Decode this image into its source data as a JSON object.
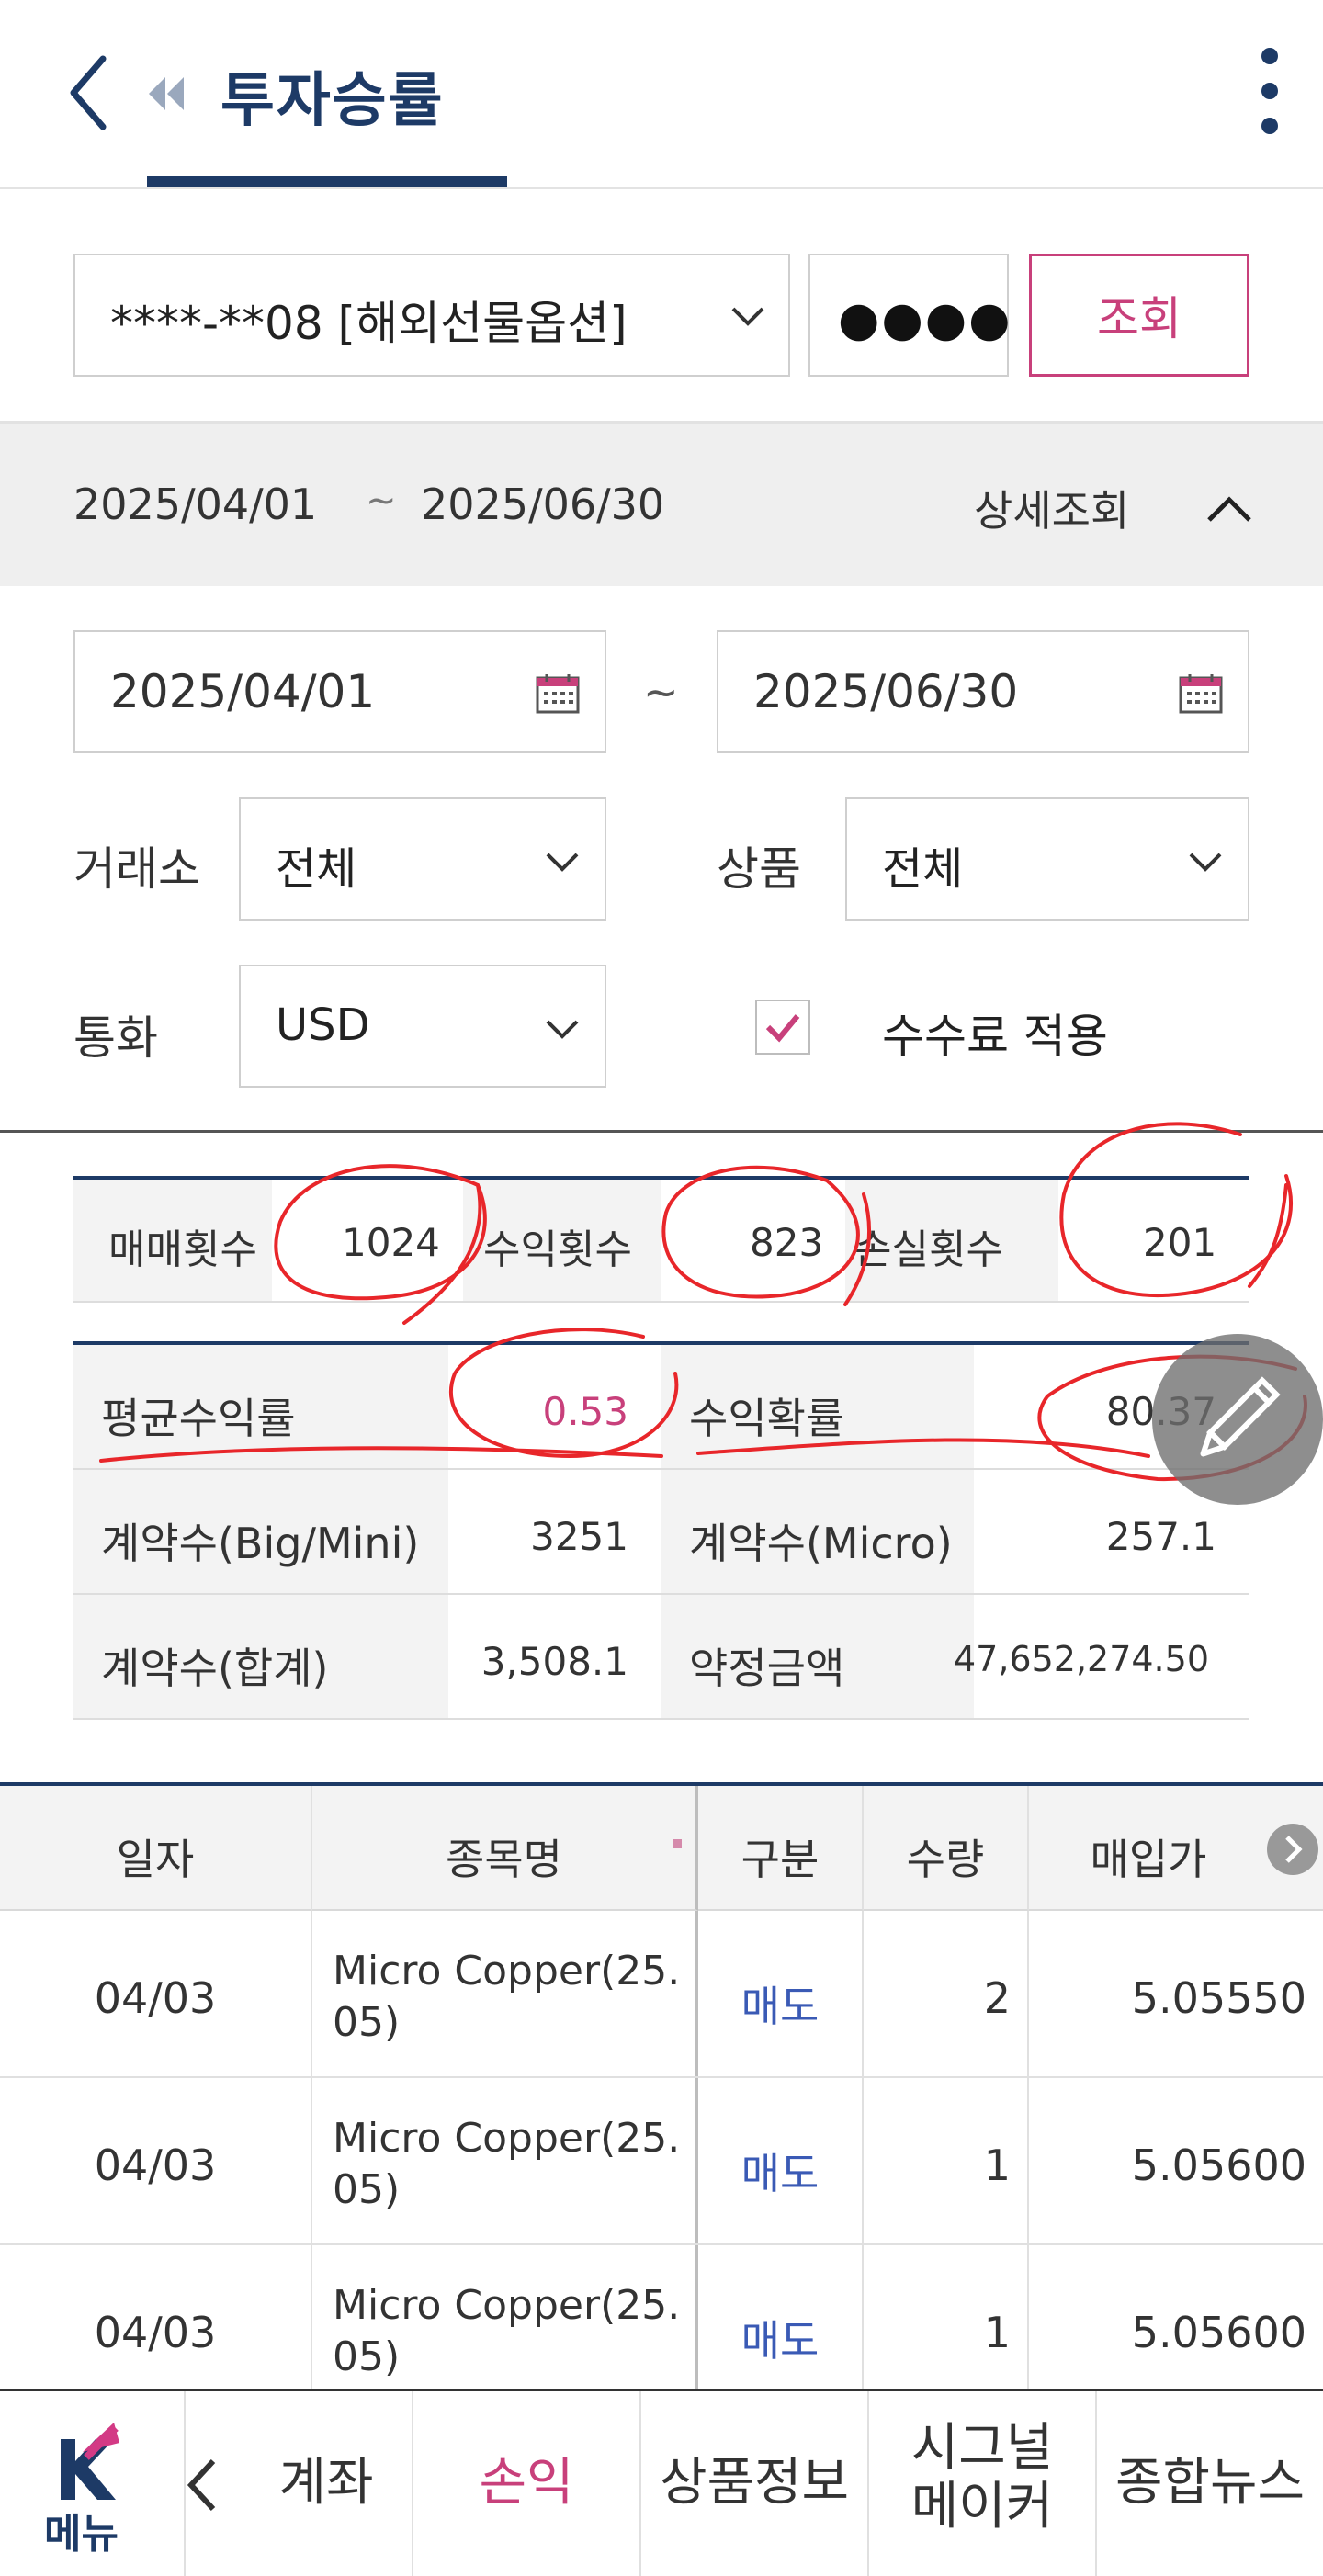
{
  "header": {
    "title": "투자승률"
  },
  "account": {
    "selected": "****-**08 [해외선물옵션]",
    "password_mask": "●●●●",
    "query_label": "조회"
  },
  "period": {
    "start": "2025/04/01",
    "separator": "~",
    "end": "2025/06/30",
    "detail_label": "상세조회"
  },
  "date_range": {
    "start": "2025/04/01",
    "separator": "~",
    "end": "2025/06/30"
  },
  "filters": {
    "exchange_label": "거래소",
    "exchange_value": "전체",
    "product_label": "상품",
    "product_value": "전체",
    "currency_label": "통화",
    "currency_value": "USD",
    "fee_label": "수수료 적용",
    "fee_checked": true
  },
  "stats1": {
    "trades_label": "매매횟수",
    "trades_value": "1024",
    "wins_label": "수익횟수",
    "wins_value": "823",
    "losses_label": "손실횟수",
    "losses_value": "201"
  },
  "stats2": {
    "avg_return_label": "평균수익률",
    "avg_return_value": "0.53",
    "win_rate_label": "수익확률",
    "win_rate_value": "80.37",
    "contracts_big_label": "계약수(Big/Mini)",
    "contracts_big_value": "3251",
    "contracts_micro_label": "계약수(Micro)",
    "contracts_micro_value": "257.1",
    "contracts_total_label": "계약수(합계)",
    "contracts_total_value": "3,508.1",
    "amount_label": "약정금액",
    "amount_value": "47,652,274.50"
  },
  "table": {
    "headers": [
      "일자",
      "종목명",
      "구분",
      "수량",
      "매입가"
    ],
    "rows": [
      {
        "date": "04/03",
        "name": "Micro Copper(25.05)",
        "side": "매도",
        "qty": "2",
        "price": "5.05550"
      },
      {
        "date": "04/03",
        "name": "Micro Copper(25.05)",
        "side": "매도",
        "qty": "1",
        "price": "5.05600"
      },
      {
        "date": "04/03",
        "name": "Micro Copper(25.05)",
        "side": "매도",
        "qty": "1",
        "price": "5.05600"
      }
    ]
  },
  "bottom_nav": {
    "menu_label": "메뉴",
    "items": [
      "계좌",
      "손익",
      "상품정보",
      "시그널\n메이커",
      "종합뉴스"
    ],
    "active_index": 1
  },
  "colors": {
    "brand_navy": "#1d3a66",
    "accent_pink": "#c8407b",
    "sell_blue": "#3a5ab5",
    "annotation_red": "#e8262a"
  }
}
